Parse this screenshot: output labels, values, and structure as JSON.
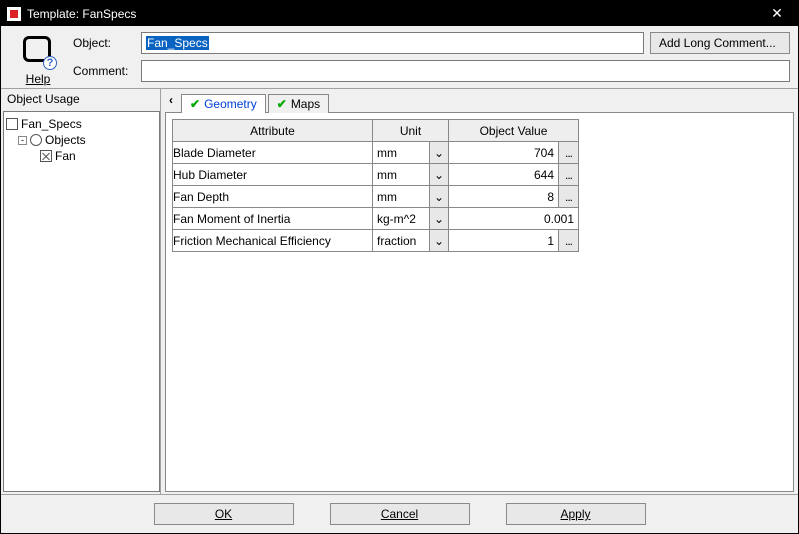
{
  "title": "Template: FanSpecs",
  "top": {
    "help_label": "Help",
    "object_label": "Object:",
    "comment_label": "Comment:",
    "object_value": "Fan_Specs",
    "comment_value": "",
    "add_long_label": "Add Long Comment..."
  },
  "left": {
    "title": "Object Usage",
    "tree": [
      {
        "label": "Fan_Specs",
        "level": 0,
        "icon": "square-icon"
      },
      {
        "label": "Objects",
        "level": 1,
        "icon": "circle-icon",
        "expander": "-"
      },
      {
        "label": "Fan",
        "level": 2,
        "icon": "cross-box-icon"
      }
    ]
  },
  "tabs": [
    {
      "label": "Geometry",
      "active": true
    },
    {
      "label": "Maps",
      "active": false
    }
  ],
  "table": {
    "headers": {
      "attr": "Attribute",
      "unit": "Unit",
      "val": "Object Value"
    },
    "rows": [
      {
        "attr": "Blade Diameter",
        "unit": "mm",
        "val": "704",
        "more": true
      },
      {
        "attr": "Hub Diameter",
        "unit": "mm",
        "val": "644",
        "more": true
      },
      {
        "attr": "Fan Depth",
        "unit": "mm",
        "val": "8",
        "more": true
      },
      {
        "attr": "Fan Moment of Inertia",
        "unit": "kg-m^2",
        "val": "0.001",
        "more": false
      },
      {
        "attr": "Friction Mechanical Efficiency",
        "unit": "fraction",
        "val": "1",
        "more": true
      }
    ]
  },
  "buttons": {
    "ok": "OK",
    "cancel": "Cancel",
    "apply": "Apply"
  },
  "glyphs": {
    "chevron_left": "‹",
    "chevron_down": "⌄",
    "check": "✔",
    "close": "✕",
    "more": "..."
  }
}
